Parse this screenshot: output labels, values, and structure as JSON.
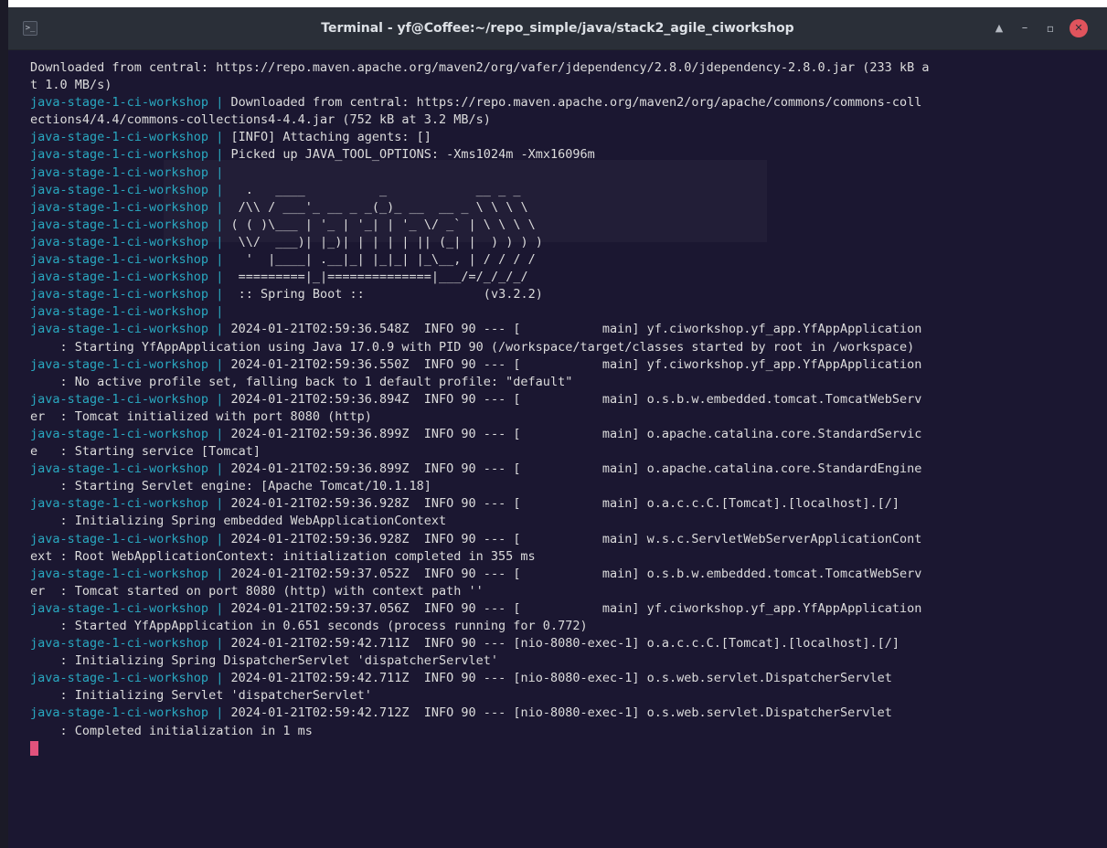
{
  "window": {
    "title": "Terminal - yf@Coffee:~/repo_simple/java/stack2_agile_ciworkshop",
    "app_icon": "terminal-icon",
    "controls": [
      {
        "name": "shade",
        "glyph": "▲"
      },
      {
        "name": "minimize",
        "glyph": "–"
      },
      {
        "name": "maximize",
        "glyph": "▫"
      },
      {
        "name": "close",
        "glyph": "✕"
      }
    ]
  },
  "colors": {
    "prefix": "#29a8c0",
    "text": "#dcdcdc",
    "background": "#1b1731",
    "cursor": "#e1527c",
    "close_button": "#e0545d"
  },
  "terminal": {
    "prefix": "java-stage-1-ci-workshop",
    "separator": " | ",
    "lines": [
      {
        "p": false,
        "t": "Downloaded from central: https://repo.maven.apache.org/maven2/org/vafer/jdependency/2.8.0/jdependency-2.8.0.jar (233 kB a"
      },
      {
        "p": false,
        "t": "t 1.0 MB/s)"
      },
      {
        "p": true,
        "t": "Downloaded from central: https://repo.maven.apache.org/maven2/org/apache/commons/commons-coll"
      },
      {
        "p": false,
        "t": "ections4/4.4/commons-collections4-4.4.jar (752 kB at 3.2 MB/s)"
      },
      {
        "p": true,
        "t": "[INFO] Attaching agents: []"
      },
      {
        "p": true,
        "t": "Picked up JAVA_TOOL_OPTIONS: -Xms1024m -Xmx16096m"
      },
      {
        "p": true,
        "t": ""
      },
      {
        "p": true,
        "t": "  .   ____          _            __ _ _"
      },
      {
        "p": true,
        "t": " /\\\\ / ___'_ __ _ _(_)_ __  __ _ \\ \\ \\ \\"
      },
      {
        "p": true,
        "t": "( ( )\\___ | '_ | '_| | '_ \\/ _` | \\ \\ \\ \\"
      },
      {
        "p": true,
        "t": " \\\\/  ___)| |_)| | | | | || (_| |  ) ) ) )"
      },
      {
        "p": true,
        "t": "  '  |____| .__|_| |_|_| |_\\__, | / / / /"
      },
      {
        "p": true,
        "t": " =========|_|==============|___/=/_/_/_/"
      },
      {
        "p": true,
        "t": " :: Spring Boot ::                (v3.2.2)"
      },
      {
        "p": true,
        "t": ""
      },
      {
        "p": true,
        "t": "2024-01-21T02:59:36.548Z  INFO 90 --- [           main] yf.ciworkshop.yf_app.YfAppApplication"
      },
      {
        "p": false,
        "t": "    : Starting YfAppApplication using Java 17.0.9 with PID 90 (/workspace/target/classes started by root in /workspace)"
      },
      {
        "p": true,
        "t": "2024-01-21T02:59:36.550Z  INFO 90 --- [           main] yf.ciworkshop.yf_app.YfAppApplication"
      },
      {
        "p": false,
        "t": "    : No active profile set, falling back to 1 default profile: \"default\""
      },
      {
        "p": true,
        "t": "2024-01-21T02:59:36.894Z  INFO 90 --- [           main] o.s.b.w.embedded.tomcat.TomcatWebServ"
      },
      {
        "p": false,
        "t": "er  : Tomcat initialized with port 8080 (http)"
      },
      {
        "p": true,
        "t": "2024-01-21T02:59:36.899Z  INFO 90 --- [           main] o.apache.catalina.core.StandardServic"
      },
      {
        "p": false,
        "t": "e   : Starting service [Tomcat]"
      },
      {
        "p": true,
        "t": "2024-01-21T02:59:36.899Z  INFO 90 --- [           main] o.apache.catalina.core.StandardEngine"
      },
      {
        "p": false,
        "t": "    : Starting Servlet engine: [Apache Tomcat/10.1.18]"
      },
      {
        "p": true,
        "t": "2024-01-21T02:59:36.928Z  INFO 90 --- [           main] o.a.c.c.C.[Tomcat].[localhost].[/]"
      },
      {
        "p": false,
        "t": "    : Initializing Spring embedded WebApplicationContext"
      },
      {
        "p": true,
        "t": "2024-01-21T02:59:36.928Z  INFO 90 --- [           main] w.s.c.ServletWebServerApplicationCont"
      },
      {
        "p": false,
        "t": "ext : Root WebApplicationContext: initialization completed in 355 ms"
      },
      {
        "p": true,
        "t": "2024-01-21T02:59:37.052Z  INFO 90 --- [           main] o.s.b.w.embedded.tomcat.TomcatWebServ"
      },
      {
        "p": false,
        "t": "er  : Tomcat started on port 8080 (http) with context path ''"
      },
      {
        "p": true,
        "t": "2024-01-21T02:59:37.056Z  INFO 90 --- [           main] yf.ciworkshop.yf_app.YfAppApplication"
      },
      {
        "p": false,
        "t": "    : Started YfAppApplication in 0.651 seconds (process running for 0.772)"
      },
      {
        "p": true,
        "t": "2024-01-21T02:59:42.711Z  INFO 90 --- [nio-8080-exec-1] o.a.c.c.C.[Tomcat].[localhost].[/]"
      },
      {
        "p": false,
        "t": "    : Initializing Spring DispatcherServlet 'dispatcherServlet'"
      },
      {
        "p": true,
        "t": "2024-01-21T02:59:42.711Z  INFO 90 --- [nio-8080-exec-1] o.s.web.servlet.DispatcherServlet"
      },
      {
        "p": false,
        "t": "    : Initializing Servlet 'dispatcherServlet'"
      },
      {
        "p": true,
        "t": "2024-01-21T02:59:42.712Z  INFO 90 --- [nio-8080-exec-1] o.s.web.servlet.DispatcherServlet"
      },
      {
        "p": false,
        "t": "    : Completed initialization in 1 ms"
      }
    ]
  }
}
